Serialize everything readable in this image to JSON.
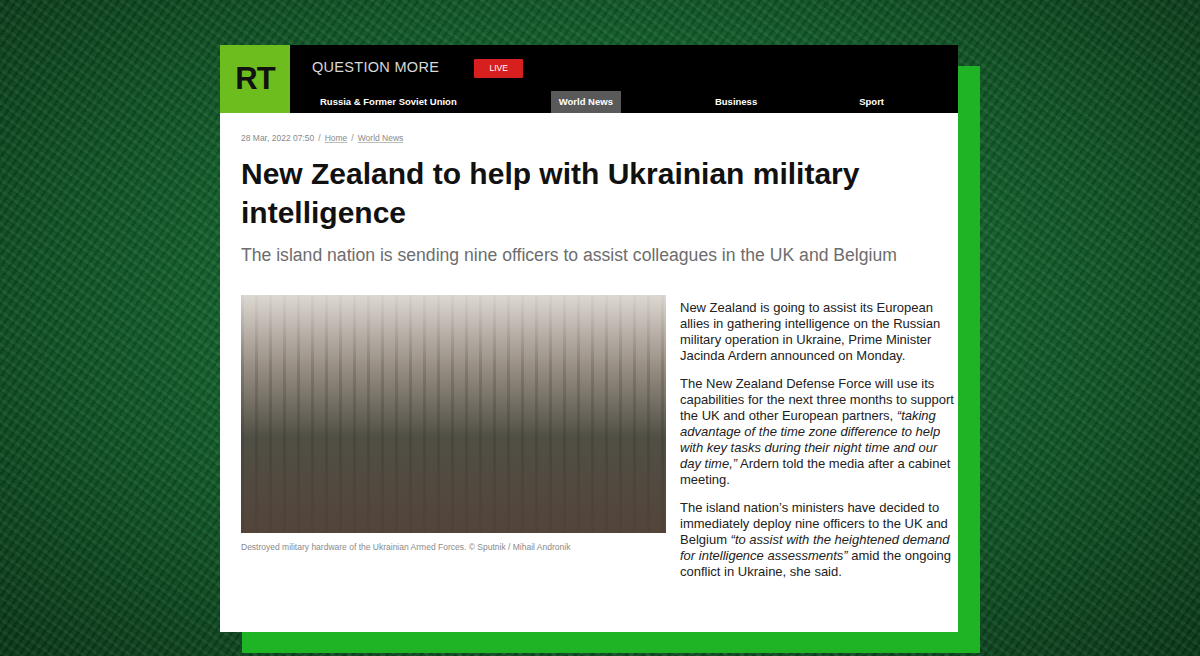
{
  "logo": {
    "text": "RT"
  },
  "header": {
    "tagline": "QUESTION MORE",
    "live": "LIVE"
  },
  "nav": [
    {
      "label": "Russia & Former Soviet Union",
      "selected": false
    },
    {
      "label": "World News",
      "selected": true
    },
    {
      "label": "Business",
      "selected": false
    },
    {
      "label": "Sport",
      "selected": false
    }
  ],
  "breadcrumb": {
    "date": "28 Mar, 2022 07:50",
    "separator": "/",
    "links": [
      "Home",
      "World News"
    ]
  },
  "article": {
    "headline": "New Zealand to help with Ukrainian military intelligence",
    "subtitle": "The island nation is sending nine officers to assist colleagues in the UK and Belgium",
    "image_caption": "Destroyed military hardware of the Ukrainian Armed Forces. © Sputnik / Mihail Andronik",
    "paragraphs": [
      [
        {
          "text": "New Zealand is going to assist its European allies in gathering intelligence on the Russian military operation in Ukraine, Prime Minister Jacinda Ardern announced on Monday.",
          "italic": false
        }
      ],
      [
        {
          "text": "The New Zealand Defense Force will use its capabilities for the next three months to support the UK and other European partners, ",
          "italic": false
        },
        {
          "text": "“taking advantage of the time zone difference to help with key tasks during their night time and our day time,”",
          "italic": true
        },
        {
          "text": " Ardern told the media after a cabinet meeting.",
          "italic": false
        }
      ],
      [
        {
          "text": "The island nation’s ministers have decided to immediately deploy nine officers to the UK and Belgium ",
          "italic": false
        },
        {
          "text": "“to assist with the heightened demand for intelligence assessments”",
          "italic": true
        },
        {
          "text": " amid the ongoing conflict in Ukraine, she said.",
          "italic": false
        }
      ]
    ]
  }
}
